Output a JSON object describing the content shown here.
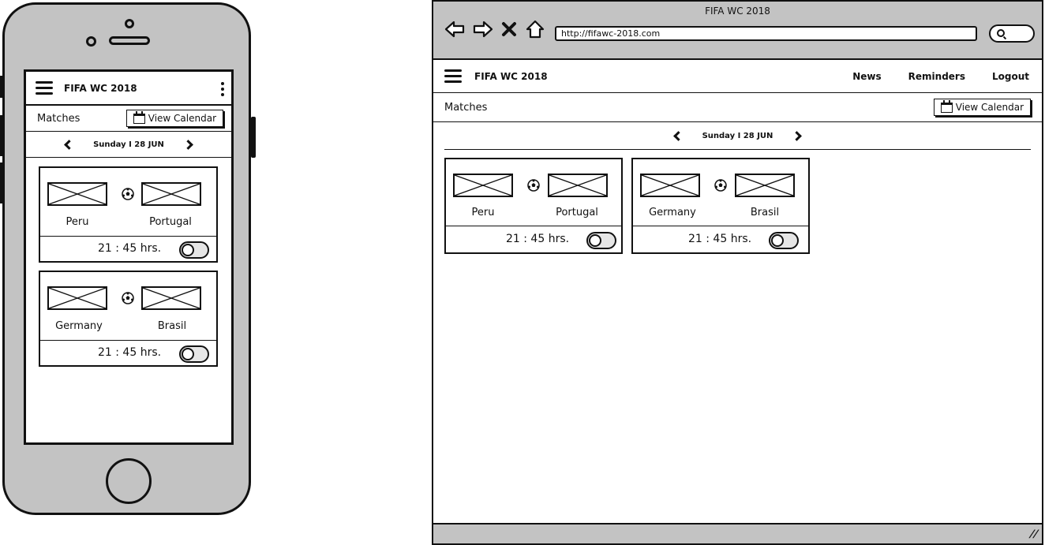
{
  "phone": {
    "app_title": "FIFA WC 2018",
    "section_label": "Matches",
    "calendar_button": "View Calendar",
    "date_label": "Sunday I 28 JUN",
    "matches": [
      {
        "home": "Peru",
        "away": "Portugal",
        "time": "21 : 45 hrs."
      },
      {
        "home": "Germany",
        "away": "Brasil",
        "time": "21 : 45 hrs."
      }
    ]
  },
  "browser": {
    "window_title": "FIFA WC 2018",
    "url": "http://fifawc-2018.com",
    "app_title": "FIFA WC 2018",
    "nav_links": [
      "News",
      "Reminders",
      "Logout"
    ],
    "section_label": "Matches",
    "calendar_button": "View Calendar",
    "date_label": "Sunday I 28 JUN",
    "matches": [
      {
        "home": "Peru",
        "away": "Portugal",
        "time": "21 : 45 hrs."
      },
      {
        "home": "Germany",
        "away": "Brasil",
        "time": "21 : 45 hrs."
      }
    ]
  },
  "colors": {
    "chrome_gray": "#c3c3c3",
    "ink": "#111111"
  }
}
